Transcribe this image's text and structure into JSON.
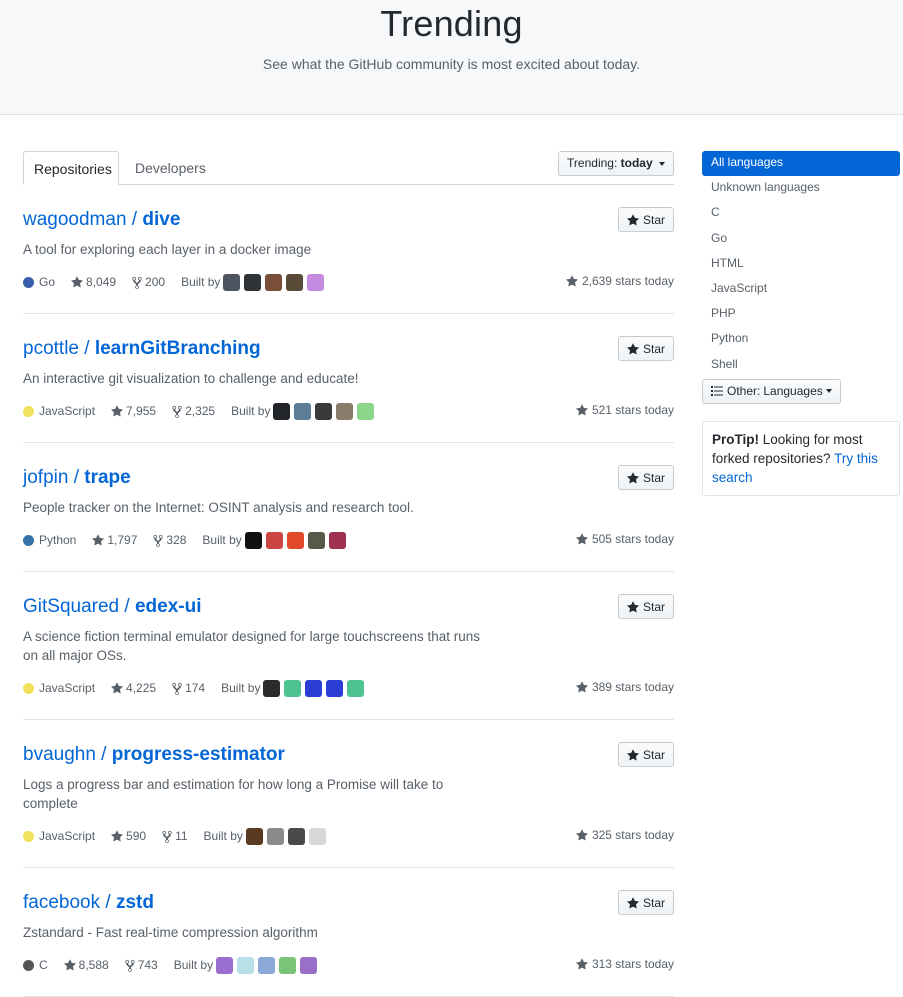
{
  "header": {
    "title": "Trending",
    "subtitle": "See what the GitHub community is most excited about today."
  },
  "tabs": {
    "repositories": "Repositories",
    "developers": "Developers"
  },
  "trending_menu": {
    "label": "Trending:",
    "value": "today"
  },
  "star_label": "Star",
  "built_by_label": "Built by",
  "repos": [
    {
      "owner": "wagoodman",
      "sep": " / ",
      "name": "dive",
      "description": "A tool for exploring each layer in a docker image",
      "language": "Go",
      "language_color": "#375eab",
      "stars": "8,049",
      "forks": "200",
      "stars_today": "2,639 stars today",
      "avatar_colors": [
        "#4d5660",
        "#2e3338",
        "#7a4f3a",
        "#5a4a38",
        "#c58be0"
      ]
    },
    {
      "owner": "pcottle",
      "sep": " / ",
      "name": "learnGitBranching",
      "description": "An interactive git visualization to challenge and educate!",
      "language": "JavaScript",
      "language_color": "#f1e05a",
      "stars": "7,955",
      "forks": "2,325",
      "stars_today": "521 stars today",
      "avatar_colors": [
        "#22262a",
        "#5c7d95",
        "#3a3a3a",
        "#8a7a6a",
        "#8bd68b"
      ]
    },
    {
      "owner": "jofpin",
      "sep": " / ",
      "name": "trape",
      "description": "People tracker on the Internet: OSINT analysis and research tool.",
      "language": "Python",
      "language_color": "#3572A5",
      "stars": "1,797",
      "forks": "328",
      "stars_today": "505 stars today",
      "avatar_colors": [
        "#111111",
        "#c44",
        "#e04a2a",
        "#555a4a",
        "#a03050"
      ]
    },
    {
      "owner": "GitSquared",
      "sep": " / ",
      "name": "edex-ui",
      "description": "A science fiction terminal emulator designed for large touchscreens that runs on all major OSs.",
      "language": "JavaScript",
      "language_color": "#f1e05a",
      "stars": "4,225",
      "forks": "174",
      "stars_today": "389 stars today",
      "avatar_colors": [
        "#2a2a2a",
        "#4fc38f",
        "#2b3fd6",
        "#2b3fd6",
        "#4fc38f"
      ]
    },
    {
      "owner": "bvaughn",
      "sep": " / ",
      "name": "progress-estimator",
      "description": "Logs a progress bar and estimation for how long a Promise will take to complete",
      "language": "JavaScript",
      "language_color": "#f1e05a",
      "stars": "590",
      "forks": "11",
      "stars_today": "325 stars today",
      "avatar_colors": [
        "#5a3a20",
        "#8a8a8a",
        "#4a4a4a",
        "#d8d8d8"
      ]
    },
    {
      "owner": "facebook",
      "sep": " / ",
      "name": "zstd",
      "description": "Zstandard - Fast real-time compression algorithm",
      "language": "C",
      "language_color": "#555555",
      "stars": "8,588",
      "forks": "743",
      "stars_today": "313 stars today",
      "avatar_colors": [
        "#9b6fd1",
        "#b7e0e8",
        "#8aa8d8",
        "#7ac47a",
        "#9a6fc8"
      ]
    }
  ],
  "languages": [
    "All languages",
    "Unknown languages",
    "C",
    "Go",
    "HTML",
    "JavaScript",
    "PHP",
    "Python",
    "Shell"
  ],
  "other_button": {
    "label": "Other:",
    "value": "Languages"
  },
  "protip": {
    "bold": "ProTip!",
    "text": " Looking for most forked repositories? ",
    "link": "Try this search"
  }
}
